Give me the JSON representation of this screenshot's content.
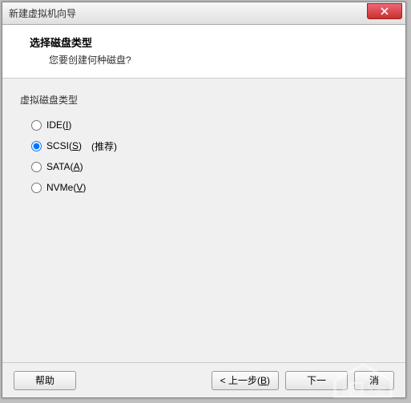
{
  "titlebar": {
    "text": "新建虚拟机向导"
  },
  "header": {
    "title": "选择磁盘类型",
    "subtitle": "您要创建何种磁盘?"
  },
  "group": {
    "label": "虚拟磁盘类型"
  },
  "options": {
    "ide": {
      "prefix": "IDE(",
      "key": "I",
      "suffix": ")"
    },
    "scsi": {
      "prefix": "SCSI(",
      "key": "S",
      "suffix": ")",
      "recommend": "(推荐)"
    },
    "sata": {
      "prefix": "SATA(",
      "key": "A",
      "suffix": ")"
    },
    "nvme": {
      "prefix": "NVMe(",
      "key": "V",
      "suffix": ")"
    }
  },
  "footer": {
    "help": "帮助",
    "back_prefix": "< 上一步(",
    "back_key": "B",
    "back_suffix": ")",
    "next": "下一",
    "cancel": "消"
  },
  "selected": "scsi"
}
